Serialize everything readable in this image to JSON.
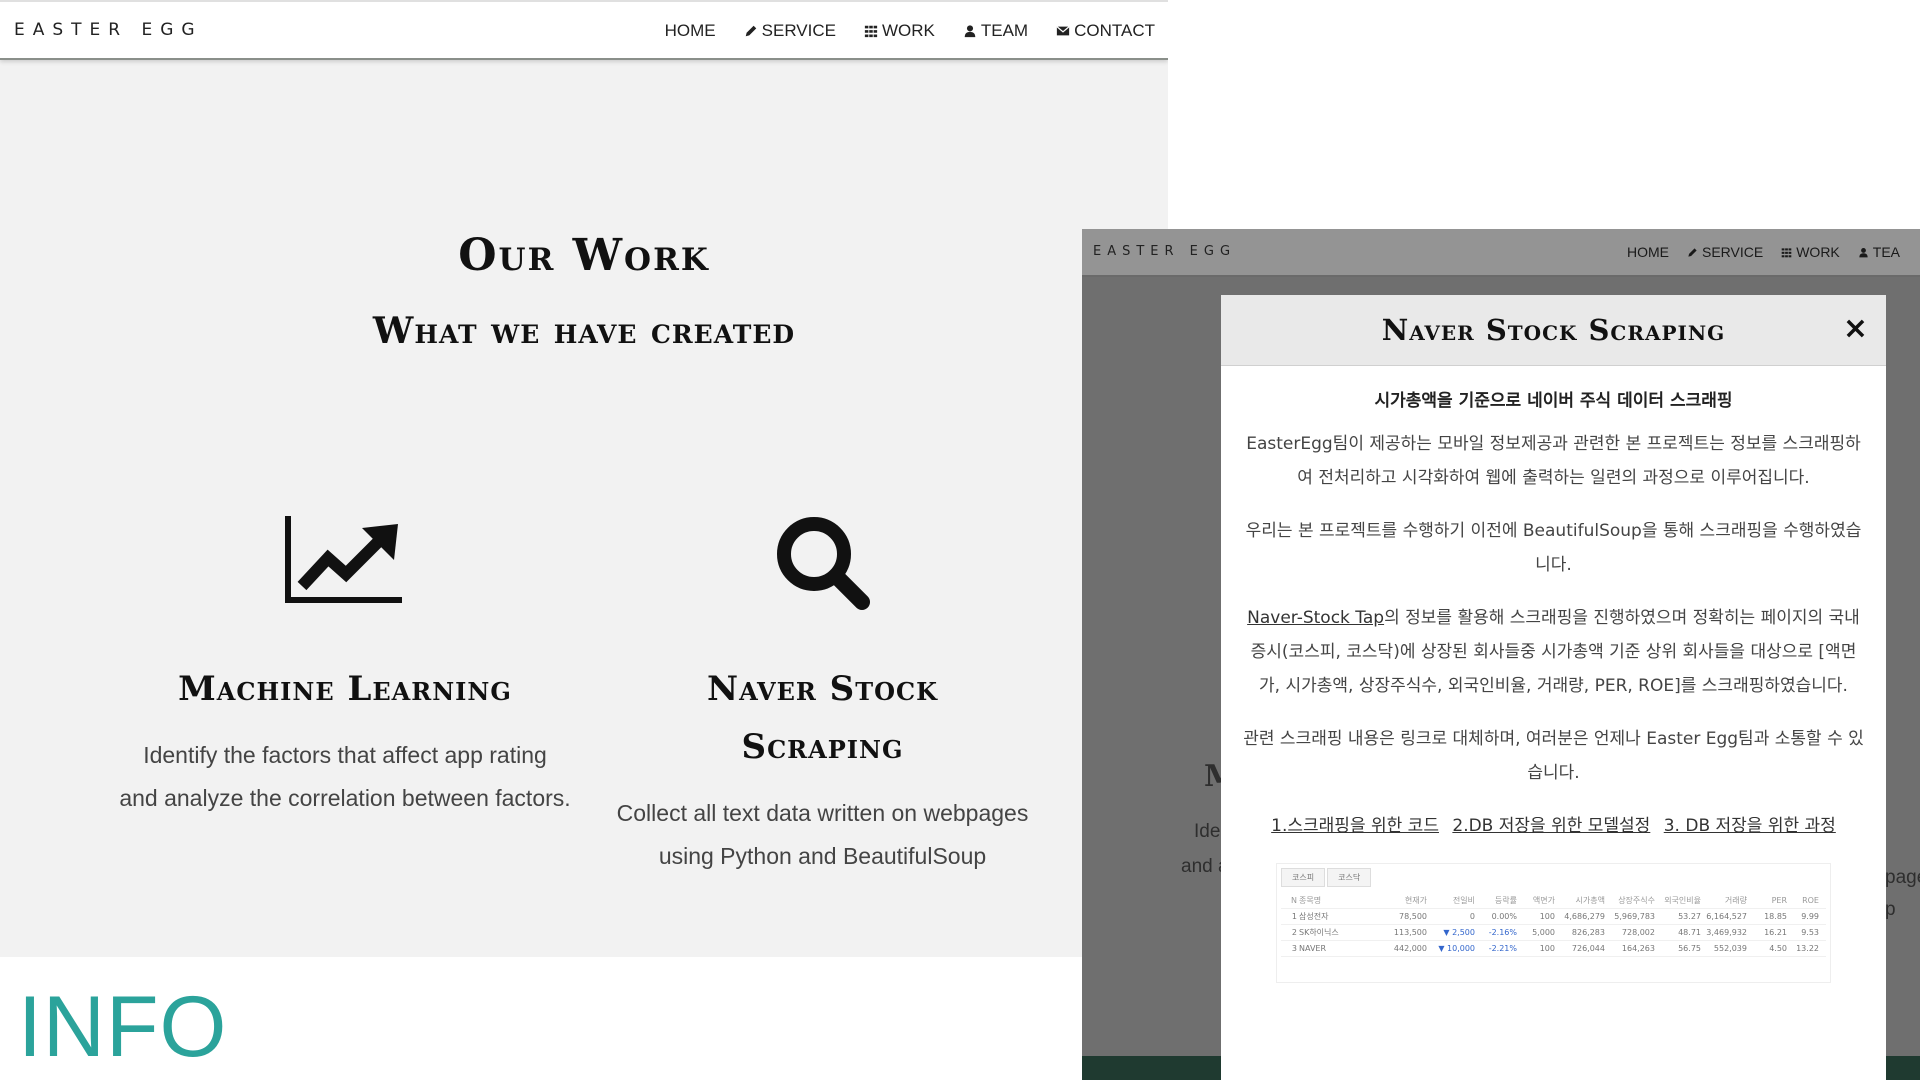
{
  "site": {
    "brand": "EASTER EGG",
    "nav": [
      "HOME",
      "SERVICE",
      "WORK",
      "TEAM",
      "CONTACT"
    ]
  },
  "work": {
    "title": "Our Work",
    "subtitle": "What we have created",
    "cards": [
      {
        "icon": "chart-line-icon",
        "title": "Machine Learning",
        "desc_line1": "Identify the factors that affect app rating",
        "desc_line2": "and analyze the correlation between factors."
      },
      {
        "icon": "search-icon",
        "title_line1": "Naver Stock",
        "title_line2": "Scraping",
        "desc_line1": "Collect all text data written on webpages",
        "desc_line2": "using Python and BeautifulSoup"
      }
    ]
  },
  "info": {
    "label": "INFO"
  },
  "dim_page": {
    "nav": [
      "HOME",
      "SERVICE",
      "WORK",
      "TEA"
    ],
    "frag_m": "M",
    "frag_ide": "Ide",
    "frag_and": "and a",
    "frag_page": "page",
    "frag_p": "p"
  },
  "modal": {
    "title": "Naver Stock Scraping",
    "close": "×",
    "subtitle": "시가총액을 기준으로 네이버 주식 데이터 스크래핑",
    "p1": "EasterEgg팀이 제공하는 모바일 정보제공과 관련한 본 프로젝트는 정보를 스크래핑하여 전처리하고 시각화하여 웹에 출력하는 일련의 과정으로 이루어집니다.",
    "p2": "우리는 본 프로젝트를 수행하기 이전에 BeautifulSoup을 통해 스크래핑을 수행하였습니다.",
    "p3_link": "Naver-Stock Tap",
    "p3_rest": "의 정보를 활용해 스크래핑을 진행하였으며 정확히는 페이지의 국내증시(코스피, 코스닥)에 상장된 회사들중 시가총액 기준 상위 회사들을 대상으로 [액면가, 시가총액, 상장주식수, 외국인비율, 거래량, PER, ROE]를 스크래핑하였습니다.",
    "p4": "관련 스크래핑 내용은 링크로 대체하며, 여러분은 언제나 Easter Egg팀과 소통할 수 있습니다.",
    "links": [
      "1.스크래핑을 위한 코드",
      "2.DB 저장을 위한 모델설정",
      "3. DB 저장을 위한 과정"
    ],
    "table": {
      "tabs": [
        "코스피",
        "코스닥"
      ],
      "headers": [
        "N",
        "종목명",
        "현재가",
        "전일비",
        "등락률",
        "액면가",
        "시가총액",
        "상장주식수",
        "외국인비율",
        "거래량",
        "PER",
        "ROE"
      ],
      "rows": [
        [
          "1",
          "삼성전자",
          "78,500",
          "0",
          "0.00%",
          "100",
          "4,686,279",
          "5,969,783",
          "53.27",
          "6,164,527",
          "18.85",
          "9.99"
        ],
        [
          "2",
          "SK하이닉스",
          "113,500",
          "▼ 2,500",
          "-2.16%",
          "5,000",
          "826,283",
          "728,002",
          "48.71",
          "3,469,932",
          "16.21",
          "9.53"
        ],
        [
          "3",
          "NAVER",
          "442,000",
          "▼ 10,000",
          "-2.21%",
          "100",
          "726,044",
          "164,263",
          "56.75",
          "552,039",
          "4.50",
          "13.22"
        ]
      ]
    }
  }
}
